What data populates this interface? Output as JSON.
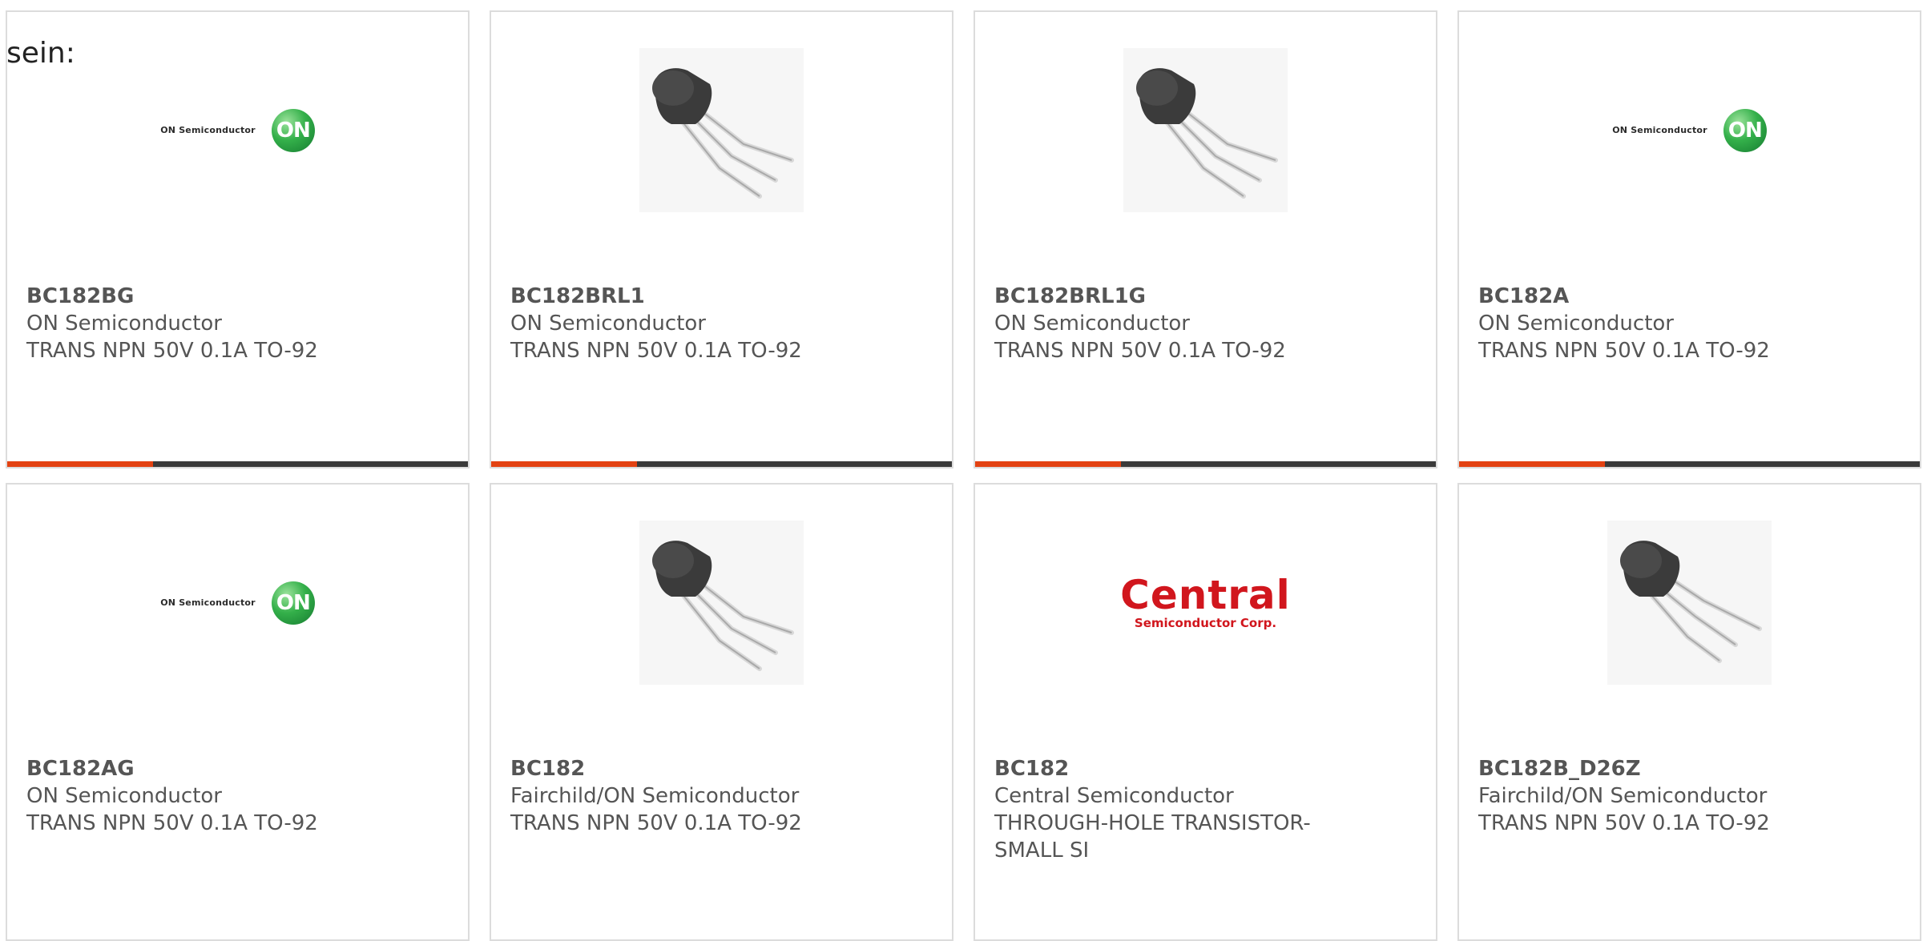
{
  "intro_text": "sein:",
  "cards": [
    {
      "part_number": "BC182BG",
      "manufacturer": "ON Semiconductor",
      "description": "TRANS NPN 50V 0.1A TO-92",
      "image": "on-semiconductor-logo",
      "accent_color": "#e34212"
    },
    {
      "part_number": "BC182BRL1",
      "manufacturer": "ON Semiconductor",
      "description": "TRANS NPN 50V 0.1A TO-92",
      "image": "to92-transistor-photo",
      "accent_color": "#e34212"
    },
    {
      "part_number": "BC182BRL1G",
      "manufacturer": "ON Semiconductor",
      "description": "TRANS NPN 50V 0.1A TO-92",
      "image": "to92-transistor-photo",
      "accent_color": "#e34212"
    },
    {
      "part_number": "BC182A",
      "manufacturer": "ON Semiconductor",
      "description": "TRANS NPN 50V 0.1A TO-92",
      "image": "on-semiconductor-logo",
      "accent_color": "#e34212"
    },
    {
      "part_number": "BC182AG",
      "manufacturer": "ON Semiconductor",
      "description": "TRANS NPN 50V 0.1A TO-92",
      "image": "on-semiconductor-logo"
    },
    {
      "part_number": "BC182",
      "manufacturer": "Fairchild/ON Semiconductor",
      "description": "TRANS NPN 50V 0.1A TO-92",
      "image": "to92-transistor-photo"
    },
    {
      "part_number": "BC182",
      "manufacturer": "Central Semiconductor",
      "description": "THROUGH-HOLE TRANSISTOR-SMALL SI",
      "image": "central-semiconductor-logo"
    },
    {
      "part_number": "BC182B_D26Z",
      "manufacturer": "Fairchild/ON Semiconductor",
      "description": "TRANS NPN 50V 0.1A TO-92",
      "image": "to92-transistor-photo"
    }
  ],
  "logos": {
    "on_semi_wordmark": "ON Semiconductor",
    "on_semi_badge": "ON",
    "central_main": "Central",
    "central_sub": "Semiconductor Corp."
  },
  "colors": {
    "accent": "#e34212",
    "bar": "#3a3a3a",
    "border": "#dcdcdc",
    "text": "#555555"
  }
}
